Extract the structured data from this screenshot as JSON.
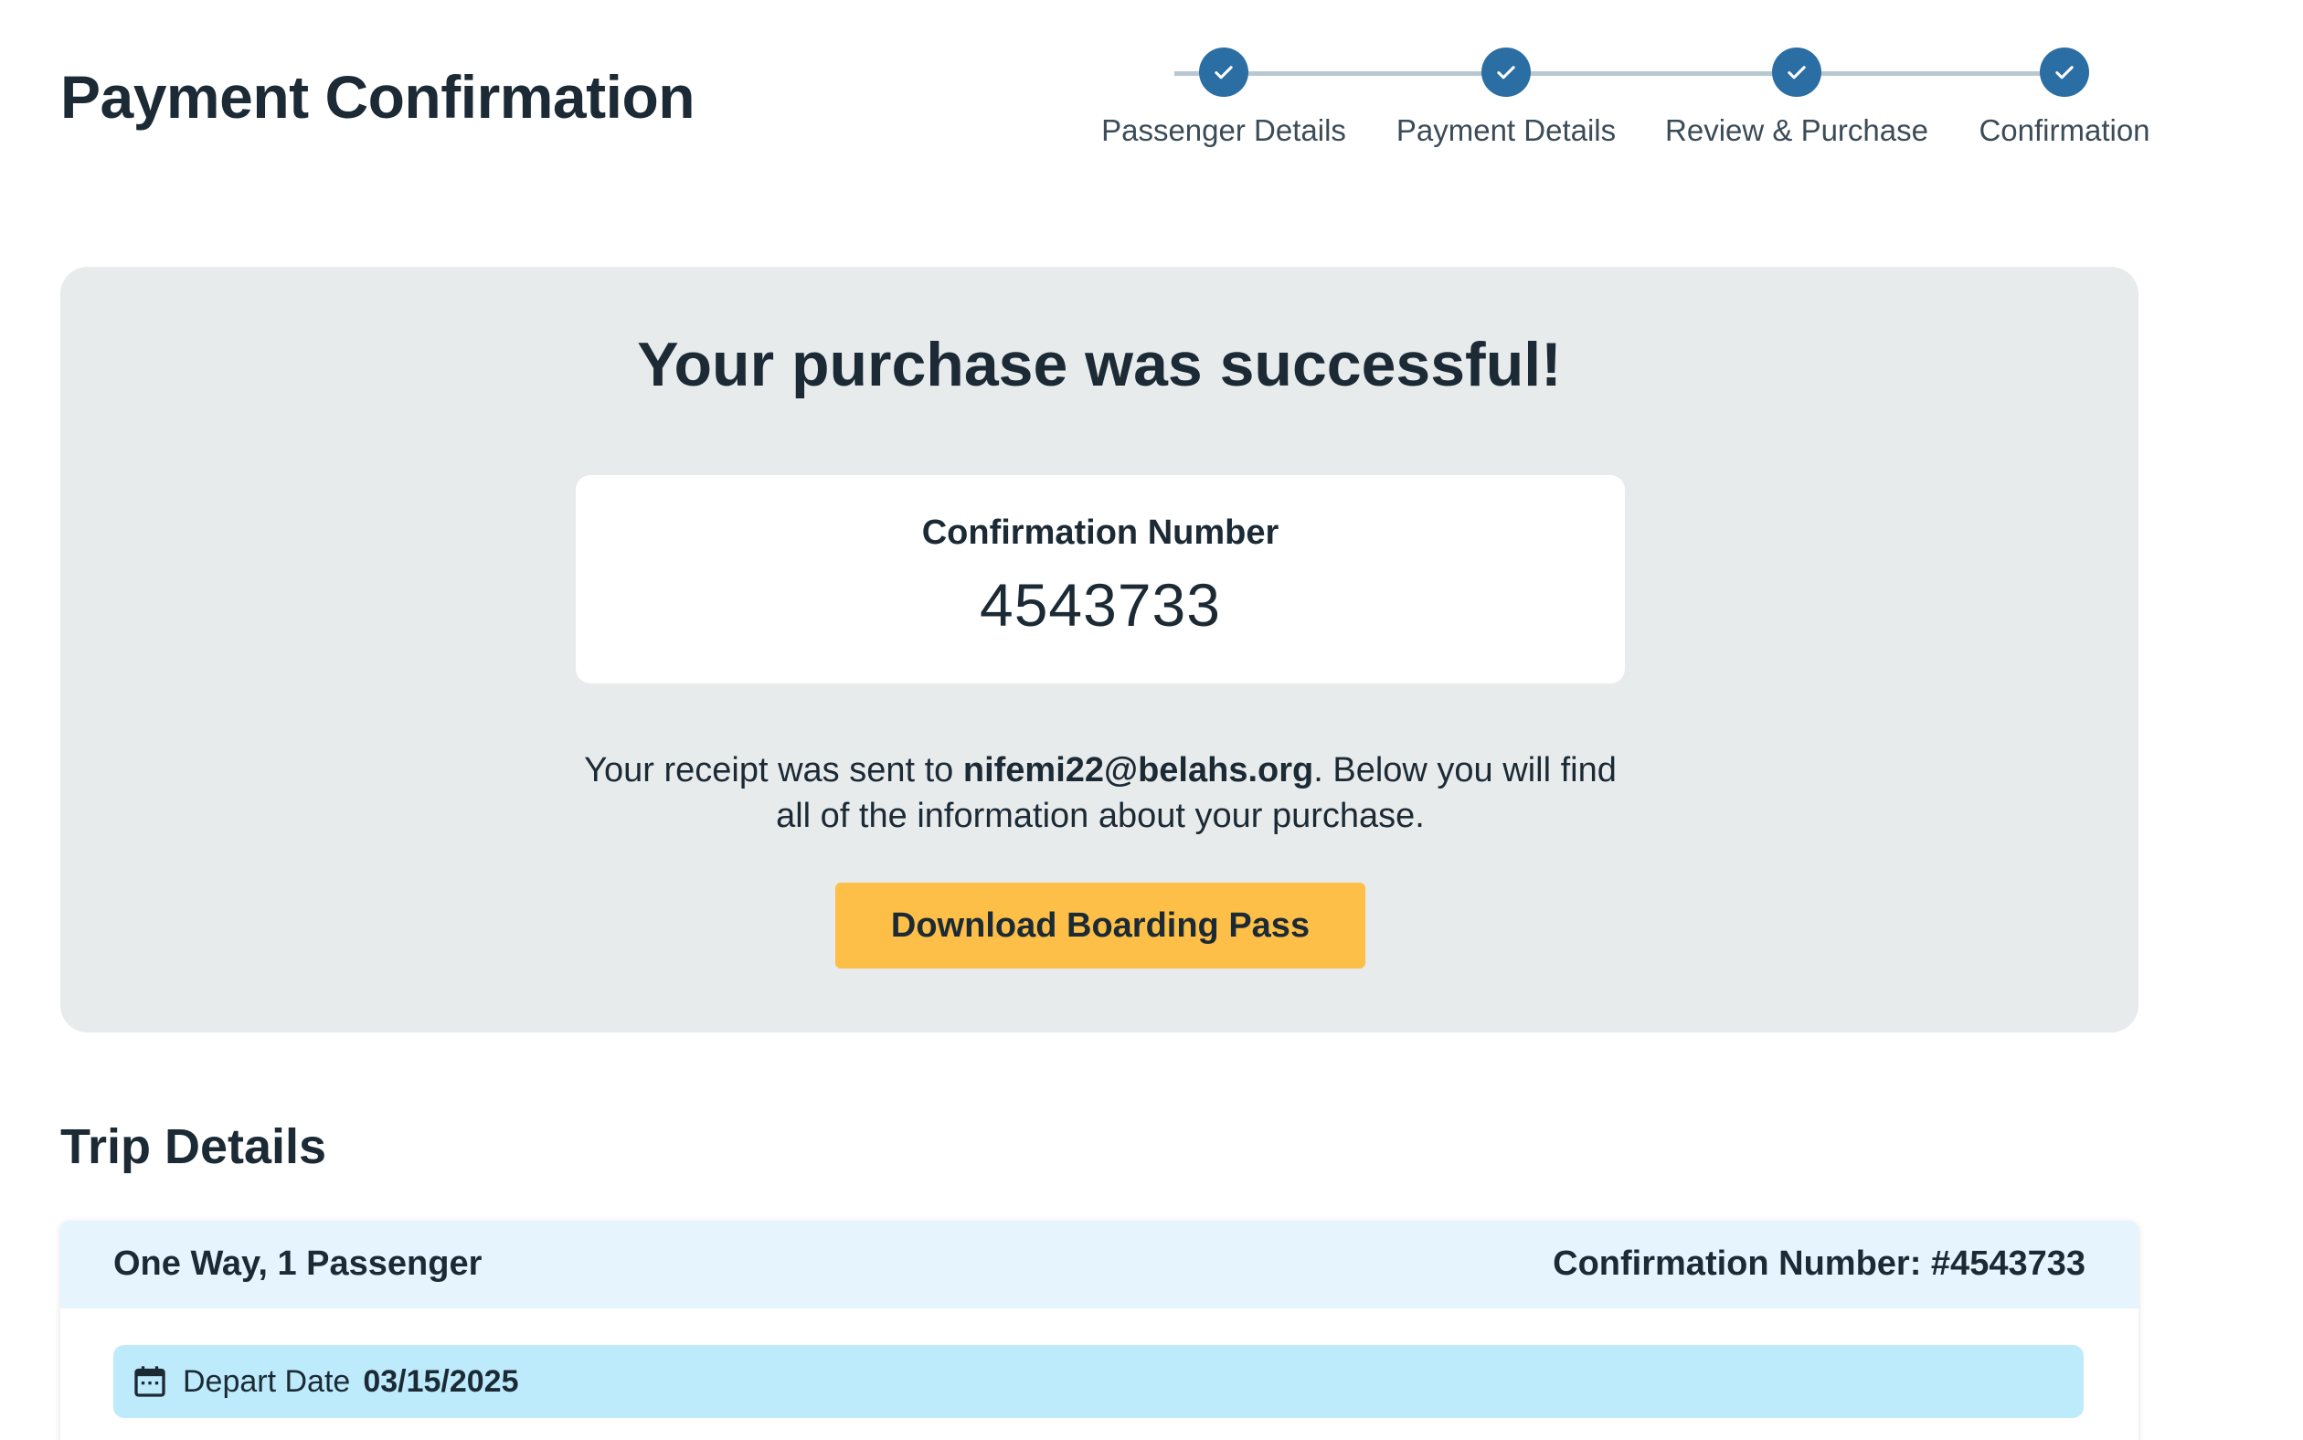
{
  "header": {
    "title": "Payment Confirmation"
  },
  "stepper": {
    "steps": [
      {
        "label": "Passenger Details",
        "status": "complete"
      },
      {
        "label": "Payment Details",
        "status": "complete"
      },
      {
        "label": "Review & Purchase",
        "status": "complete"
      },
      {
        "label": "Confirmation",
        "status": "complete"
      }
    ],
    "icon": "checkmark-icon",
    "color": "#2b6ea3"
  },
  "success": {
    "heading": "Your purchase was successful!",
    "confirmation_label": "Confirmation Number",
    "confirmation_number": "4543733",
    "receipt_prefix": "Your receipt was sent to ",
    "receipt_email": "nifemi22@belahs.org",
    "receipt_suffix": ". Below you will find all of the information about your purchase.",
    "download_label": "Download Boarding Pass",
    "button_color": "#fdbf47"
  },
  "trip": {
    "section_title": "Trip Details",
    "trip_type": "One Way, 1 Passenger",
    "confirmation": "Confirmation Number: #4543733",
    "depart_label": "Depart Date",
    "depart_date": "03/15/2025",
    "depart_icon": "calendar-icon"
  }
}
